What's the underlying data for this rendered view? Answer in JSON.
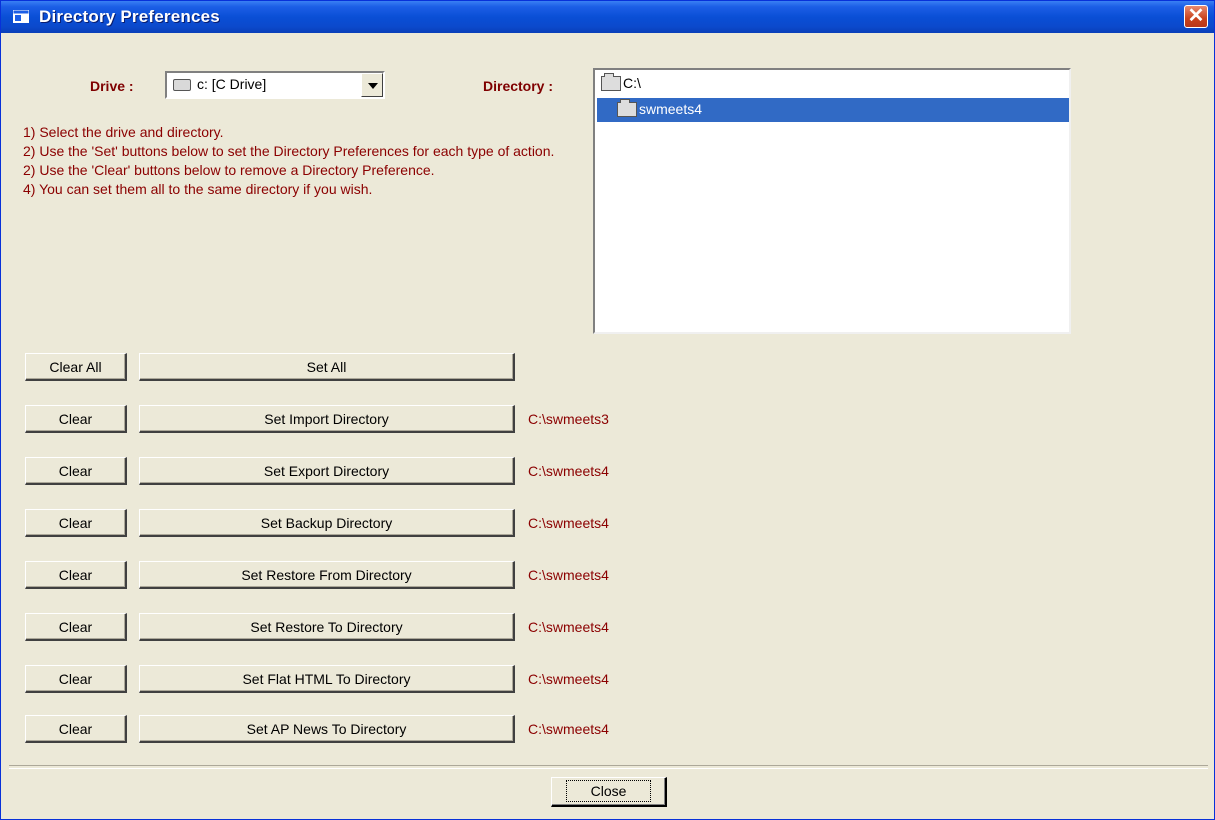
{
  "window": {
    "title": "Directory Preferences",
    "close_glyph": "✕"
  },
  "drive": {
    "label": "Drive :",
    "value": "c: [C Drive]"
  },
  "directory": {
    "label": "Directory :",
    "items": [
      {
        "name": "C:\\",
        "icon": "open-folder-icon",
        "selected": false
      },
      {
        "name": "swmeets4",
        "icon": "open-folder-icon",
        "selected": true
      }
    ]
  },
  "instructions": [
    "1) Select the drive and directory.",
    "2) Use the 'Set' buttons below to set the Directory Preferences for each type of action.",
    "2) Use the 'Clear' buttons below to remove a Directory Preference.",
    "4) You can set them all to the same directory if you wish."
  ],
  "all_row": {
    "clear_label": "Clear All",
    "set_label": "Set All"
  },
  "rows": [
    {
      "clear_label": "Clear",
      "set_label": "Set Import Directory",
      "path": "C:\\swmeets3"
    },
    {
      "clear_label": "Clear",
      "set_label": "Set Export Directory",
      "path": "C:\\swmeets4"
    },
    {
      "clear_label": "Clear",
      "set_label": "Set Backup Directory",
      "path": "C:\\swmeets4"
    },
    {
      "clear_label": "Clear",
      "set_label": "Set Restore From Directory",
      "path": "C:\\swmeets4"
    },
    {
      "clear_label": "Clear",
      "set_label": "Set Restore To Directory",
      "path": "C:\\swmeets4"
    },
    {
      "clear_label": "Clear",
      "set_label": "Set Flat HTML To Directory",
      "path": "C:\\swmeets4"
    },
    {
      "clear_label": "Clear",
      "set_label": "Set AP News To Directory",
      "path": "C:\\swmeets4"
    }
  ],
  "footer": {
    "close_label": "Close"
  },
  "colors": {
    "accent_text": "#8b0000",
    "selection": "#316ac5",
    "titlebar": "#0a4fd6"
  }
}
